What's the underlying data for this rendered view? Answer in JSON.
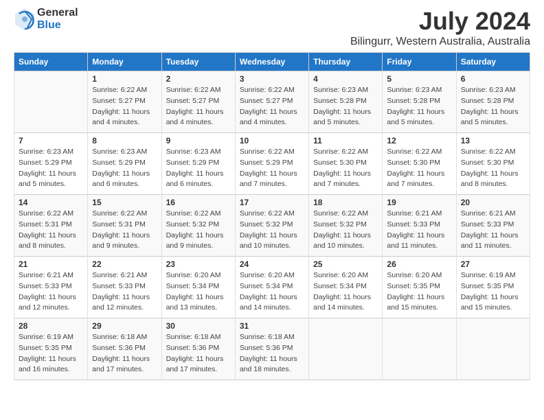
{
  "logo": {
    "general": "General",
    "blue": "Blue"
  },
  "title": "July 2024",
  "subtitle": "Bilingurr, Western Australia, Australia",
  "days_of_week": [
    "Sunday",
    "Monday",
    "Tuesday",
    "Wednesday",
    "Thursday",
    "Friday",
    "Saturday"
  ],
  "weeks": [
    [
      {
        "day": "",
        "date": "",
        "lines": []
      },
      {
        "day": "1",
        "date": "1",
        "lines": [
          "Sunrise: 6:22 AM",
          "Sunset: 5:27 PM",
          "Daylight: 11 hours",
          "and 4 minutes."
        ]
      },
      {
        "day": "2",
        "date": "2",
        "lines": [
          "Sunrise: 6:22 AM",
          "Sunset: 5:27 PM",
          "Daylight: 11 hours",
          "and 4 minutes."
        ]
      },
      {
        "day": "3",
        "date": "3",
        "lines": [
          "Sunrise: 6:22 AM",
          "Sunset: 5:27 PM",
          "Daylight: 11 hours",
          "and 4 minutes."
        ]
      },
      {
        "day": "4",
        "date": "4",
        "lines": [
          "Sunrise: 6:23 AM",
          "Sunset: 5:28 PM",
          "Daylight: 11 hours",
          "and 5 minutes."
        ]
      },
      {
        "day": "5",
        "date": "5",
        "lines": [
          "Sunrise: 6:23 AM",
          "Sunset: 5:28 PM",
          "Daylight: 11 hours",
          "and 5 minutes."
        ]
      },
      {
        "day": "6",
        "date": "6",
        "lines": [
          "Sunrise: 6:23 AM",
          "Sunset: 5:28 PM",
          "Daylight: 11 hours",
          "and 5 minutes."
        ]
      }
    ],
    [
      {
        "day": "7",
        "date": "7",
        "lines": [
          "Sunrise: 6:23 AM",
          "Sunset: 5:29 PM",
          "Daylight: 11 hours",
          "and 5 minutes."
        ]
      },
      {
        "day": "8",
        "date": "8",
        "lines": [
          "Sunrise: 6:23 AM",
          "Sunset: 5:29 PM",
          "Daylight: 11 hours",
          "and 6 minutes."
        ]
      },
      {
        "day": "9",
        "date": "9",
        "lines": [
          "Sunrise: 6:23 AM",
          "Sunset: 5:29 PM",
          "Daylight: 11 hours",
          "and 6 minutes."
        ]
      },
      {
        "day": "10",
        "date": "10",
        "lines": [
          "Sunrise: 6:22 AM",
          "Sunset: 5:29 PM",
          "Daylight: 11 hours",
          "and 7 minutes."
        ]
      },
      {
        "day": "11",
        "date": "11",
        "lines": [
          "Sunrise: 6:22 AM",
          "Sunset: 5:30 PM",
          "Daylight: 11 hours",
          "and 7 minutes."
        ]
      },
      {
        "day": "12",
        "date": "12",
        "lines": [
          "Sunrise: 6:22 AM",
          "Sunset: 5:30 PM",
          "Daylight: 11 hours",
          "and 7 minutes."
        ]
      },
      {
        "day": "13",
        "date": "13",
        "lines": [
          "Sunrise: 6:22 AM",
          "Sunset: 5:30 PM",
          "Daylight: 11 hours",
          "and 8 minutes."
        ]
      }
    ],
    [
      {
        "day": "14",
        "date": "14",
        "lines": [
          "Sunrise: 6:22 AM",
          "Sunset: 5:31 PM",
          "Daylight: 11 hours",
          "and 8 minutes."
        ]
      },
      {
        "day": "15",
        "date": "15",
        "lines": [
          "Sunrise: 6:22 AM",
          "Sunset: 5:31 PM",
          "Daylight: 11 hours",
          "and 9 minutes."
        ]
      },
      {
        "day": "16",
        "date": "16",
        "lines": [
          "Sunrise: 6:22 AM",
          "Sunset: 5:32 PM",
          "Daylight: 11 hours",
          "and 9 minutes."
        ]
      },
      {
        "day": "17",
        "date": "17",
        "lines": [
          "Sunrise: 6:22 AM",
          "Sunset: 5:32 PM",
          "Daylight: 11 hours",
          "and 10 minutes."
        ]
      },
      {
        "day": "18",
        "date": "18",
        "lines": [
          "Sunrise: 6:22 AM",
          "Sunset: 5:32 PM",
          "Daylight: 11 hours",
          "and 10 minutes."
        ]
      },
      {
        "day": "19",
        "date": "19",
        "lines": [
          "Sunrise: 6:21 AM",
          "Sunset: 5:33 PM",
          "Daylight: 11 hours",
          "and 11 minutes."
        ]
      },
      {
        "day": "20",
        "date": "20",
        "lines": [
          "Sunrise: 6:21 AM",
          "Sunset: 5:33 PM",
          "Daylight: 11 hours",
          "and 11 minutes."
        ]
      }
    ],
    [
      {
        "day": "21",
        "date": "21",
        "lines": [
          "Sunrise: 6:21 AM",
          "Sunset: 5:33 PM",
          "Daylight: 11 hours",
          "and 12 minutes."
        ]
      },
      {
        "day": "22",
        "date": "22",
        "lines": [
          "Sunrise: 6:21 AM",
          "Sunset: 5:33 PM",
          "Daylight: 11 hours",
          "and 12 minutes."
        ]
      },
      {
        "day": "23",
        "date": "23",
        "lines": [
          "Sunrise: 6:20 AM",
          "Sunset: 5:34 PM",
          "Daylight: 11 hours",
          "and 13 minutes."
        ]
      },
      {
        "day": "24",
        "date": "24",
        "lines": [
          "Sunrise: 6:20 AM",
          "Sunset: 5:34 PM",
          "Daylight: 11 hours",
          "and 14 minutes."
        ]
      },
      {
        "day": "25",
        "date": "25",
        "lines": [
          "Sunrise: 6:20 AM",
          "Sunset: 5:34 PM",
          "Daylight: 11 hours",
          "and 14 minutes."
        ]
      },
      {
        "day": "26",
        "date": "26",
        "lines": [
          "Sunrise: 6:20 AM",
          "Sunset: 5:35 PM",
          "Daylight: 11 hours",
          "and 15 minutes."
        ]
      },
      {
        "day": "27",
        "date": "27",
        "lines": [
          "Sunrise: 6:19 AM",
          "Sunset: 5:35 PM",
          "Daylight: 11 hours",
          "and 15 minutes."
        ]
      }
    ],
    [
      {
        "day": "28",
        "date": "28",
        "lines": [
          "Sunrise: 6:19 AM",
          "Sunset: 5:35 PM",
          "Daylight: 11 hours",
          "and 16 minutes."
        ]
      },
      {
        "day": "29",
        "date": "29",
        "lines": [
          "Sunrise: 6:18 AM",
          "Sunset: 5:36 PM",
          "Daylight: 11 hours",
          "and 17 minutes."
        ]
      },
      {
        "day": "30",
        "date": "30",
        "lines": [
          "Sunrise: 6:18 AM",
          "Sunset: 5:36 PM",
          "Daylight: 11 hours",
          "and 17 minutes."
        ]
      },
      {
        "day": "31",
        "date": "31",
        "lines": [
          "Sunrise: 6:18 AM",
          "Sunset: 5:36 PM",
          "Daylight: 11 hours",
          "and 18 minutes."
        ]
      },
      {
        "day": "",
        "date": "",
        "lines": []
      },
      {
        "day": "",
        "date": "",
        "lines": []
      },
      {
        "day": "",
        "date": "",
        "lines": []
      }
    ]
  ]
}
